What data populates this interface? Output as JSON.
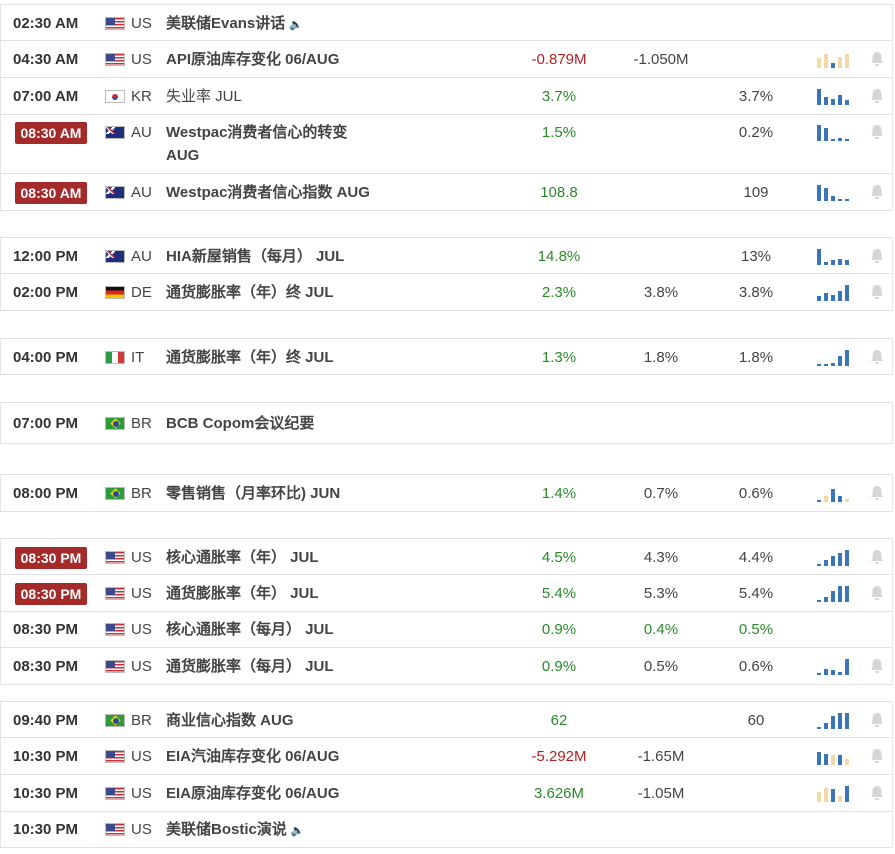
{
  "events": [
    {
      "time": "02:30 AM",
      "highlight": false,
      "flag": "us",
      "country": "US",
      "event": "美联储Evans讲话",
      "bold": true,
      "speech": true,
      "actual": "",
      "actual_color": "",
      "forecast": "",
      "forecast_color": "",
      "previous": "",
      "previous_color": "",
      "chart": [],
      "bell": false
    },
    {
      "time": "04:30 AM",
      "highlight": false,
      "flag": "us",
      "country": "US",
      "event": "API原油库存变化 06/AUG",
      "bold": true,
      "speech": false,
      "actual": "-0.879M",
      "actual_color": "red",
      "forecast": "-1.050M",
      "forecast_color": "",
      "previous": "",
      "previous_color": "",
      "chart": [
        [
          "tan",
          0.6
        ],
        [
          "tan",
          0.9
        ],
        [
          "blue",
          0.3
        ],
        [
          "tan",
          0.7
        ],
        [
          "tan",
          0.9
        ]
      ],
      "bell": true
    },
    {
      "time": "07:00 AM",
      "highlight": false,
      "flag": "kr",
      "country": "KR",
      "event": "失业率 JUL",
      "bold": false,
      "speech": false,
      "actual": "3.7%",
      "actual_color": "green",
      "forecast": "",
      "forecast_color": "",
      "previous": "3.7%",
      "previous_color": "",
      "chart": [
        [
          "blue",
          1
        ],
        [
          "blue",
          0.5
        ],
        [
          "blue",
          0.4
        ],
        [
          "blue",
          0.6
        ],
        [
          "blue",
          0.3
        ]
      ],
      "bell": true
    },
    {
      "time": "08:30 AM",
      "highlight": true,
      "flag": "au",
      "country": "AU",
      "event": "Westpac消费者信心的转变 AUG",
      "bold": true,
      "speech": false,
      "actual": "1.5%",
      "actual_color": "green",
      "forecast": "",
      "forecast_color": "",
      "previous": "0.2%",
      "previous_color": "",
      "chart": [
        [
          "blue",
          1
        ],
        [
          "blue",
          0.8
        ],
        [
          "blue",
          0.1
        ],
        [
          "blue",
          0.2
        ],
        [
          "blue",
          0.1
        ]
      ],
      "bell": true
    },
    {
      "time": "08:30 AM",
      "highlight": true,
      "flag": "au",
      "country": "AU",
      "event": "Westpac消费者信心指数 AUG",
      "bold": true,
      "speech": false,
      "actual": "108.8",
      "actual_color": "green",
      "forecast": "",
      "forecast_color": "",
      "previous": "109",
      "previous_color": "",
      "chart": [
        [
          "blue",
          1
        ],
        [
          "blue",
          0.8
        ],
        [
          "blue",
          0.3
        ],
        [
          "blue",
          0.1
        ],
        [
          "blue",
          0.1
        ]
      ],
      "bell": true
    },
    {
      "time": "12:00 PM",
      "highlight": false,
      "flag": "au",
      "country": "AU",
      "event": "HIA新屋销售（每月） JUL",
      "bold": true,
      "speech": false,
      "actual": "14.8%",
      "actual_color": "green",
      "forecast": "",
      "forecast_color": "",
      "previous": "13%",
      "previous_color": "",
      "chart": [
        [
          "blue",
          1
        ],
        [
          "blue",
          0.2
        ],
        [
          "blue",
          0.3
        ],
        [
          "blue",
          0.4
        ],
        [
          "blue",
          0.3
        ]
      ],
      "bell": true
    },
    {
      "time": "02:00 PM",
      "highlight": false,
      "flag": "de",
      "country": "DE",
      "event": "通货膨胀率（年）终 JUL",
      "bold": true,
      "speech": false,
      "actual": "2.3%",
      "actual_color": "green",
      "forecast": "3.8%",
      "forecast_color": "",
      "previous": "3.8%",
      "previous_color": "",
      "chart": [
        [
          "blue",
          0.3
        ],
        [
          "blue",
          0.5
        ],
        [
          "blue",
          0.4
        ],
        [
          "blue",
          0.6
        ],
        [
          "blue",
          1
        ]
      ],
      "bell": true
    },
    {
      "time": "04:00 PM",
      "highlight": false,
      "flag": "it",
      "country": "IT",
      "event": "通货膨胀率（年）终 JUL",
      "bold": true,
      "speech": false,
      "actual": "1.3%",
      "actual_color": "green",
      "forecast": "1.8%",
      "forecast_color": "",
      "previous": "1.8%",
      "previous_color": "",
      "chart": [
        [
          "blue",
          0.1
        ],
        [
          "blue",
          0.15
        ],
        [
          "blue",
          0.2
        ],
        [
          "blue",
          0.6
        ],
        [
          "blue",
          1
        ]
      ],
      "bell": true
    },
    {
      "time": "07:00 PM",
      "highlight": false,
      "flag": "br",
      "country": "BR",
      "event": "BCB Copom会议纪要",
      "bold": true,
      "speech": false,
      "actual": "",
      "actual_color": "",
      "forecast": "",
      "forecast_color": "",
      "previous": "",
      "previous_color": "",
      "chart": [],
      "bell": false
    },
    {
      "time": "08:00 PM",
      "highlight": false,
      "flag": "br",
      "country": "BR",
      "event": "零售销售（月率环比) JUN",
      "bold": true,
      "speech": false,
      "actual": "1.4%",
      "actual_color": "green",
      "forecast": "0.7%",
      "forecast_color": "",
      "previous": "0.6%",
      "previous_color": "",
      "chart": [
        [
          "blue",
          0.1
        ],
        [
          "tan",
          0.4
        ],
        [
          "blue",
          0.8
        ],
        [
          "blue",
          0.4
        ],
        [
          "tan",
          0.2
        ]
      ],
      "bell": true
    },
    {
      "time": "08:30 PM",
      "highlight": true,
      "flag": "us",
      "country": "US",
      "event": "核心通胀率（年） JUL",
      "bold": true,
      "speech": false,
      "actual": "4.5%",
      "actual_color": "green",
      "forecast": "4.3%",
      "forecast_color": "",
      "previous": "4.4%",
      "previous_color": "",
      "chart": [
        [
          "blue",
          0.1
        ],
        [
          "blue",
          0.4
        ],
        [
          "blue",
          0.6
        ],
        [
          "blue",
          0.8
        ],
        [
          "blue",
          1
        ]
      ],
      "bell": true
    },
    {
      "time": "08:30 PM",
      "highlight": true,
      "flag": "us",
      "country": "US",
      "event": "通货膨胀率（年） JUL",
      "bold": true,
      "speech": false,
      "actual": "5.4%",
      "actual_color": "green",
      "forecast": "5.3%",
      "forecast_color": "",
      "previous": "5.4%",
      "previous_color": "",
      "chart": [
        [
          "blue",
          0.1
        ],
        [
          "blue",
          0.3
        ],
        [
          "blue",
          0.7
        ],
        [
          "blue",
          1
        ],
        [
          "blue",
          1
        ]
      ],
      "bell": true
    },
    {
      "time": "08:30 PM",
      "highlight": false,
      "flag": "us",
      "country": "US",
      "event": "核心通胀率（每月） JUL",
      "bold": true,
      "speech": false,
      "actual": "0.9%",
      "actual_color": "green",
      "forecast": "0.4%",
      "forecast_color": "green",
      "previous": "0.5%",
      "previous_color": "green",
      "chart": [],
      "bell": false
    },
    {
      "time": "08:30 PM",
      "highlight": false,
      "flag": "us",
      "country": "US",
      "event": "通货膨胀率（每月） JUL",
      "bold": true,
      "speech": false,
      "actual": "0.9%",
      "actual_color": "green",
      "forecast": "0.5%",
      "forecast_color": "",
      "previous": "0.6%",
      "previous_color": "",
      "chart": [
        [
          "blue",
          0.1
        ],
        [
          "blue",
          0.4
        ],
        [
          "blue",
          0.3
        ],
        [
          "blue",
          0.2
        ],
        [
          "blue",
          1
        ]
      ],
      "bell": true
    },
    {
      "time": "09:40 PM",
      "highlight": false,
      "flag": "br",
      "country": "BR",
      "event": "商业信心指数 AUG",
      "bold": true,
      "speech": false,
      "actual": "62",
      "actual_color": "green",
      "forecast": "",
      "forecast_color": "",
      "previous": "60",
      "previous_color": "",
      "chart": [
        [
          "blue",
          0.1
        ],
        [
          "blue",
          0.4
        ],
        [
          "blue",
          0.8
        ],
        [
          "blue",
          1
        ],
        [
          "blue",
          1
        ]
      ],
      "bell": true
    },
    {
      "time": "10:30 PM",
      "highlight": false,
      "flag": "us",
      "country": "US",
      "event": "EIA汽油库存变化 06/AUG",
      "bold": true,
      "speech": false,
      "actual": "-5.292M",
      "actual_color": "red",
      "forecast": "-1.65M",
      "forecast_color": "",
      "previous": "",
      "previous_color": "",
      "chart": [
        [
          "blue",
          0.8
        ],
        [
          "blue",
          0.7
        ],
        [
          "tan",
          0.6
        ],
        [
          "blue",
          0.6
        ],
        [
          "tan",
          0.4
        ]
      ],
      "bell": true
    },
    {
      "time": "10:30 PM",
      "highlight": false,
      "flag": "us",
      "country": "US",
      "event": "EIA原油库存变化 06/AUG",
      "bold": true,
      "speech": false,
      "actual": "3.626M",
      "actual_color": "green",
      "forecast": "-1.05M",
      "forecast_color": "",
      "previous": "",
      "previous_color": "",
      "chart": [
        [
          "tan",
          0.6
        ],
        [
          "tan",
          0.9
        ],
        [
          "blue",
          0.8
        ],
        [
          "tan",
          0.4
        ],
        [
          "blue",
          1
        ]
      ],
      "bell": true
    },
    {
      "time": "10:30 PM",
      "highlight": false,
      "flag": "us",
      "country": "US",
      "event": "美联储Bostic演说",
      "bold": true,
      "speech": true,
      "actual": "",
      "actual_color": "",
      "forecast": "",
      "forecast_color": "",
      "previous": "",
      "previous_color": "",
      "chart": [],
      "bell": false
    }
  ]
}
